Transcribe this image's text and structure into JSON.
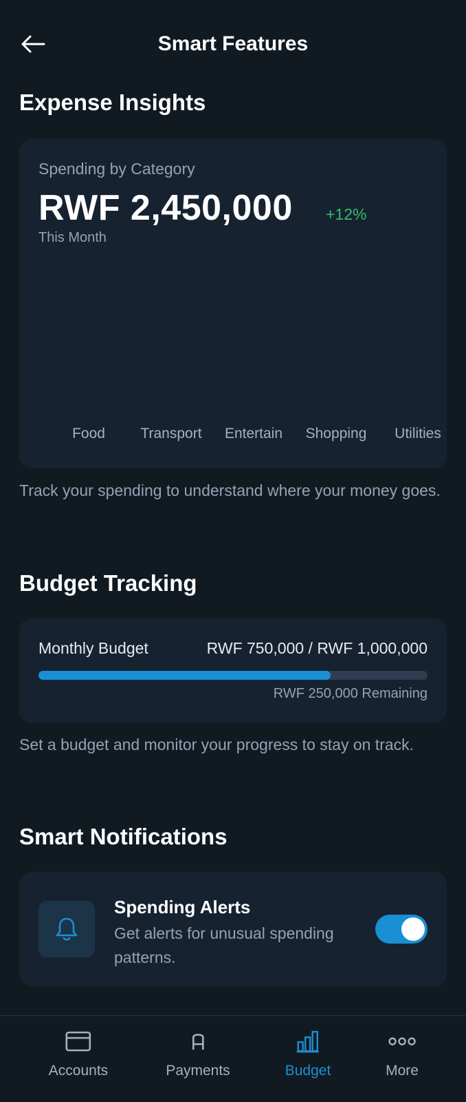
{
  "header": {
    "title": "Smart Features"
  },
  "expense": {
    "section_title": "Expense Insights",
    "card_label": "Spending by Category",
    "amount": "RWF 2,450,000",
    "change": "+12%",
    "period": "This Month",
    "description": "Track your spending to understand where your money goes."
  },
  "chart_data": {
    "type": "bar",
    "title": "Spending by Category",
    "categories": [
      "Food",
      "Transport",
      "Entertain",
      "Shopping",
      "Utilities"
    ],
    "values": [],
    "xlabel": "",
    "ylabel": ""
  },
  "budget": {
    "section_title": "Budget Tracking",
    "label": "Monthly Budget",
    "value": "RWF 750,000 / RWF 1,000,000",
    "progress_fraction": 0.75,
    "remaining": "RWF 250,000 Remaining",
    "description": "Set a budget and monitor your progress to stay on track.",
    "accent_color": "#1a8fd4"
  },
  "notifications": {
    "section_title": "Smart Notifications",
    "title": "Spending Alerts",
    "description": "Get alerts for unusual spending patterns.",
    "toggle_on": true,
    "icon": "bell-icon"
  },
  "nav": {
    "items": [
      {
        "label": "Accounts",
        "icon": "card-icon",
        "active": false
      },
      {
        "label": "Payments",
        "icon": "payments-icon",
        "active": false
      },
      {
        "label": "Budget",
        "icon": "bar-chart-icon",
        "active": true
      },
      {
        "label": "More",
        "icon": "more-dots-icon",
        "active": false
      }
    ]
  },
  "colors": {
    "background": "#111a21",
    "card": "#172230",
    "accent": "#1a8fd4",
    "positive": "#2fbf6a"
  }
}
